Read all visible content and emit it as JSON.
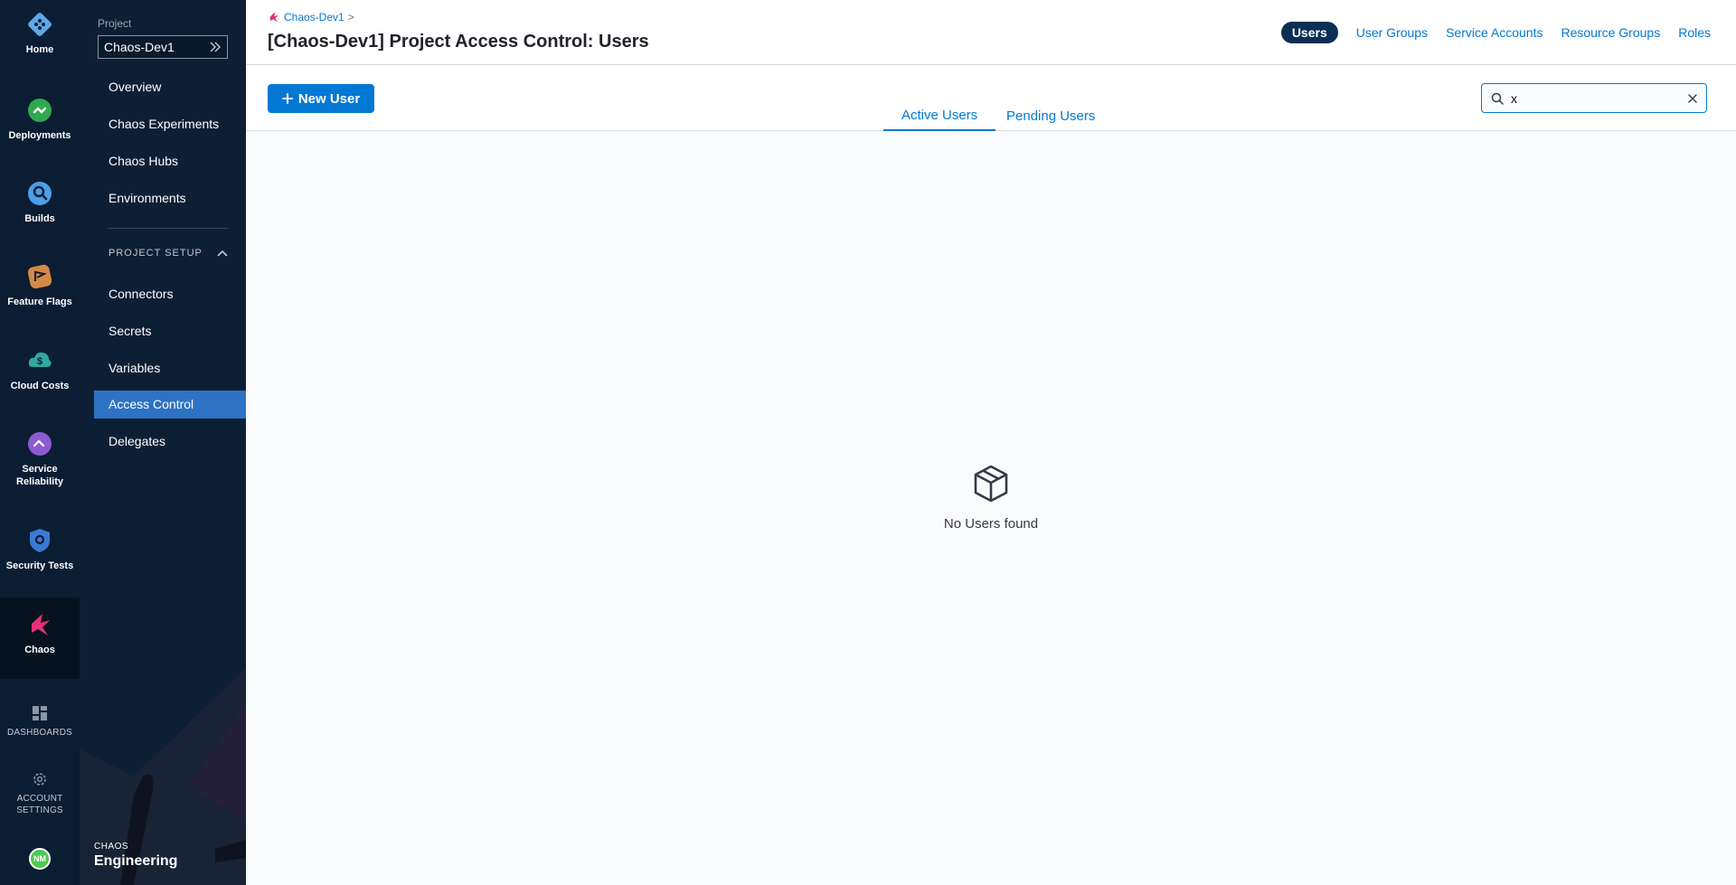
{
  "rail": {
    "items": [
      {
        "label": "Home",
        "icon": "home-icon"
      },
      {
        "label": "Deployments",
        "icon": "deployments-icon"
      },
      {
        "label": "Builds",
        "icon": "builds-icon"
      },
      {
        "label": "Feature Flags",
        "icon": "feature-flags-icon"
      },
      {
        "label": "Cloud Costs",
        "icon": "cloud-costs-icon"
      },
      {
        "label": "Service Reliability",
        "icon": "service-reliability-icon"
      },
      {
        "label": "Security Tests",
        "icon": "security-tests-icon"
      },
      {
        "label": "Chaos",
        "icon": "chaos-icon"
      }
    ],
    "dashboards": "DASHBOARDS",
    "account_settings": "ACCOUNT SETTINGS",
    "avatar_initials": "NM"
  },
  "project_nav": {
    "project_label": "Project",
    "project_name": "Chaos-Dev1",
    "links": [
      "Overview",
      "Chaos Experiments",
      "Chaos Hubs",
      "Environments"
    ],
    "section_title": "PROJECT SETUP",
    "setup_links": [
      "Connectors",
      "Secrets",
      "Variables",
      "Access Control",
      "Delegates"
    ],
    "active": "Access Control",
    "footer_small": "CHAOS",
    "footer_large": "Engineering"
  },
  "header": {
    "breadcrumb": "Chaos-Dev1",
    "breadcrumb_sep": ">",
    "title": "[Chaos-Dev1] Project Access Control: Users",
    "tabs": [
      "Users",
      "User Groups",
      "Service Accounts",
      "Resource Groups",
      "Roles"
    ],
    "selected_tab": "Users"
  },
  "toolbar": {
    "new_user_label": "New User",
    "sub_tabs": [
      "Active Users",
      "Pending Users"
    ],
    "selected_sub_tab": "Active Users",
    "search_value": "x"
  },
  "empty_state": {
    "message": "No Users found",
    "icon": "empty-box-icon"
  },
  "colors": {
    "rail_bg": "#0b1d33",
    "nav_bg": "#0d1f35",
    "accent": "#0278d5",
    "active_nav": "#2d72c4",
    "chaos_pink": "#e43274"
  }
}
